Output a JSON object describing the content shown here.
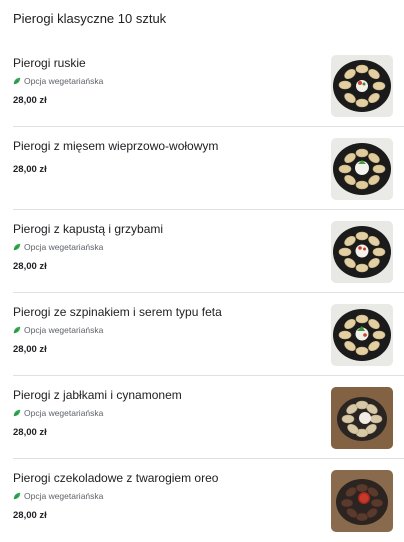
{
  "section": {
    "title": "Pierogi klasyczne 10 sztuk"
  },
  "items": [
    {
      "name": "Pierogi ruskie",
      "vegetarian_label": "Opcja wegetariańska",
      "price": "28,00 zł",
      "image": "dumplings-plate-photo"
    },
    {
      "name": "Pierogi z mięsem wieprzowo-wołowym",
      "vegetarian_label": "",
      "price": "28,00 zł",
      "image": "dumplings-plate-photo"
    },
    {
      "name": "Pierogi z kapustą i grzybami",
      "vegetarian_label": "Opcja wegetariańska",
      "price": "28,00 zł",
      "image": "dumplings-plate-photo"
    },
    {
      "name": "Pierogi ze szpinakiem i serem typu feta",
      "vegetarian_label": "Opcja wegetariańska",
      "price": "28,00 zł",
      "image": "dumplings-plate-photo"
    },
    {
      "name": "Pierogi z jabłkami i cynamonem",
      "vegetarian_label": "Opcja wegetariańska",
      "price": "28,00 zł",
      "image": "sweet-dumplings-photo"
    },
    {
      "name": "Pierogi czekoladowe z twarogiem oreo",
      "vegetarian_label": "Opcja wegetariańska",
      "price": "28,00 zł",
      "image": "chocolate-dumplings-photo"
    }
  ],
  "colors": {
    "leaf": "#34a853",
    "divider": "#e0e0e0"
  }
}
